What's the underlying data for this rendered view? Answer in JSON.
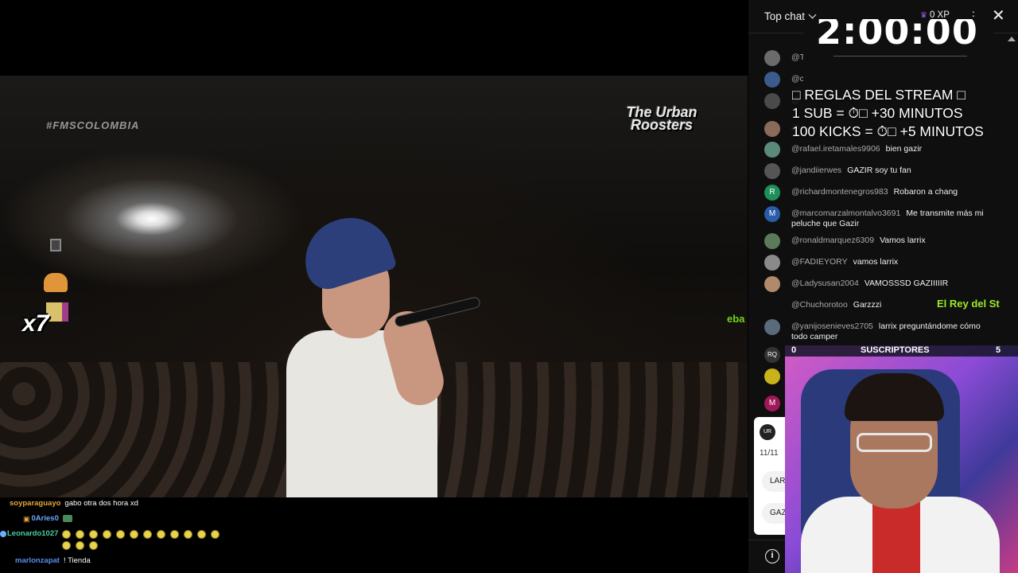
{
  "video": {
    "watermark": "#FMSCOLOMBIA",
    "brand_logo": "The Urban Roosters",
    "side_text": "eba",
    "multiplier": "x7"
  },
  "overlay_chat": [
    {
      "name": "soyparaguayo",
      "name_color": "#e8a63a",
      "message": "gabo otra dos hora xd"
    },
    {
      "name": "0Aries0",
      "name_color": "#6aa9ff",
      "message": ""
    },
    {
      "name": "Leonardo1027",
      "name_color": "#47d1a8",
      "message": ""
    },
    {
      "name": "marlonzapat",
      "name_color": "#5c8df0",
      "message": "! Tienda"
    }
  ],
  "chat": {
    "title": "Top chat",
    "xp_label": "0 XP",
    "icons": {
      "chevron": "chevron-down-icon",
      "more": "more-vert-icon",
      "close": "close-icon",
      "info": "info-icon",
      "crown": "crown-icon"
    },
    "messages": [
      {
        "author": "@T",
        "text": "",
        "avatar": "",
        "avatar_color": "#6b6b6b"
      },
      {
        "author": "@c",
        "text": "",
        "avatar": "",
        "avatar_color": "#3b5b8a"
      },
      {
        "author": "@",
        "text": "",
        "avatar": "",
        "avatar_color": "#4a4a4a"
      },
      {
        "author": "@",
        "text": "",
        "avatar": "",
        "avatar_color": "#8a6a5a"
      },
      {
        "author": "@rafael.iretamales9906",
        "text": "bien gazir",
        "avatar": "",
        "avatar_color": "#5c8a7a"
      },
      {
        "author": "@jandiierwes",
        "text": "GAZIR soy tu fan",
        "avatar": "",
        "avatar_color": "#555555"
      },
      {
        "author": "@richardmontenegros983",
        "text": "Robaron a chang",
        "avatar": "R",
        "avatar_color": "#1e8f5a"
      },
      {
        "author": "@marcomarzalmontalvo3691",
        "text": "Me transmite más mi peluche que Gazir",
        "avatar": "M",
        "avatar_color": "#2a5caa"
      },
      {
        "author": "@ronaldmarquez6309",
        "text": "Vamos larrix",
        "avatar": "",
        "avatar_color": "#5a7a5a"
      },
      {
        "author": "@FADIEYORY",
        "text": "vamos larrix",
        "avatar": "",
        "avatar_color": "#8a8a8a"
      },
      {
        "author": "@Ladysusan2004",
        "text": "VAMOSSSD GAZIIIIIR",
        "avatar": "",
        "avatar_color": "#b08a6a"
      },
      {
        "author": "@Chuchorotoo",
        "text": "Garzzzi",
        "avatar": "",
        "avatar_color": "#0f0f0f"
      },
      {
        "author": "@yanijosenieves2705",
        "text": "larrix preguntándome cómo todo camper",
        "avatar": "",
        "avatar_color": "#5a6a7a"
      }
    ]
  },
  "stream_overlay": {
    "timer": "2:00:00",
    "rules": [
      "□ REGLAS DEL STREAM □",
      "1 SUB = ⏱□ +30 MINUTOS",
      "100 KICKS = ⏱□ +5 MINUTOS"
    ],
    "king_label": "El Rey del St",
    "cam_bar": {
      "left": "0",
      "center": "SUSCRIPTORES",
      "right": "5"
    }
  },
  "chat_bottom": {
    "date": "11/11",
    "chip1": "LAR",
    "chip2": "GAZ"
  },
  "colors": {
    "chat_bg": "#0f0f0f",
    "accent_green": "#9bea2a",
    "crown": "#9b5cf0"
  }
}
